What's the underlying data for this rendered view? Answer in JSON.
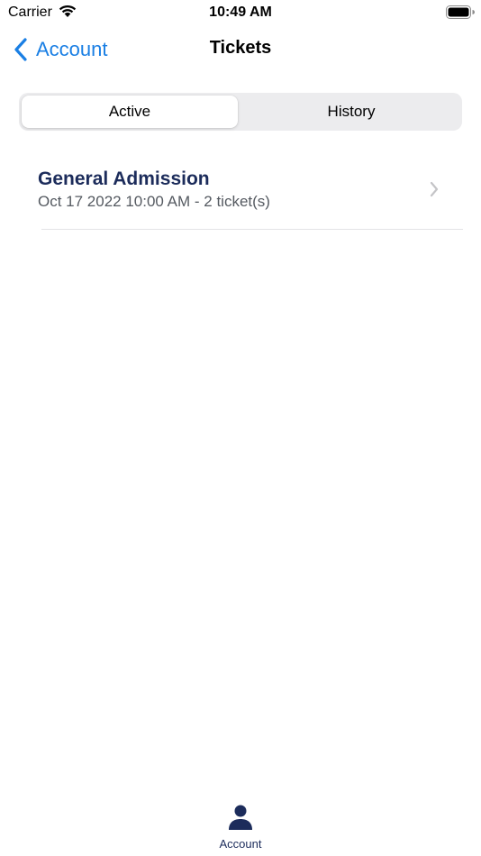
{
  "status_bar": {
    "carrier": "Carrier",
    "time": "10:49 AM"
  },
  "nav": {
    "back_label": "Account",
    "title": "Tickets"
  },
  "segments": {
    "items": [
      {
        "label": "Active",
        "selected": true
      },
      {
        "label": "History",
        "selected": false
      }
    ]
  },
  "tickets": [
    {
      "title": "General Admission",
      "subtitle": "Oct 17 2022 10:00 AM - 2 ticket(s)"
    }
  ],
  "tab_bar": {
    "items": [
      {
        "label": "Account",
        "icon": "person-icon"
      }
    ]
  },
  "colors": {
    "accent_link": "#1a7fe4",
    "brand_navy": "#1c2c5b",
    "segment_bg": "#ececee"
  }
}
